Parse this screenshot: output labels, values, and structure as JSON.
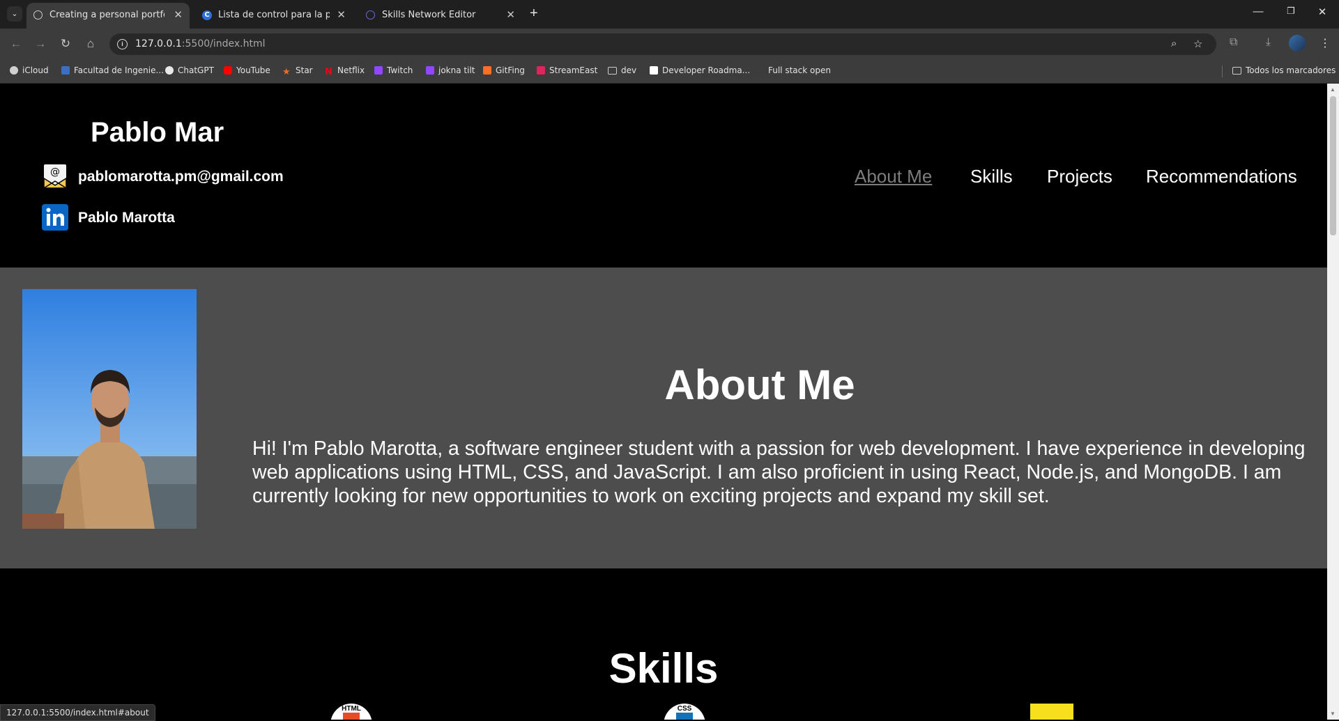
{
  "browser": {
    "tabs": [
      {
        "title": "Creating a personal portfolio",
        "active": true,
        "icon": "globe-icon"
      },
      {
        "title": "Lista de control para la present",
        "active": false,
        "icon": "c-icon"
      },
      {
        "title": "Skills Network Editor",
        "active": false,
        "icon": "editor-icon"
      }
    ],
    "url_host": "127.0.0.1",
    "url_path": ":5500/index.html",
    "bookmarks": [
      {
        "label": "iCloud",
        "icon": "apple-icon",
        "color": "#d0d0d0"
      },
      {
        "label": "Facultad de Ingenie...",
        "icon": "university-icon",
        "color": "#3a6fc4"
      },
      {
        "label": "ChatGPT",
        "icon": "chatgpt-icon",
        "color": "#e8e8e8"
      },
      {
        "label": "YouTube",
        "icon": "youtube-icon",
        "color": "#ff0000"
      },
      {
        "label": "Star",
        "icon": "star-icon",
        "color": "#f06a28"
      },
      {
        "label": "Netflix",
        "icon": "netflix-icon",
        "color": "#e50914"
      },
      {
        "label": "Twitch",
        "icon": "twitch-icon",
        "color": "#9146ff"
      },
      {
        "label": "jokna tilt",
        "icon": "twitch-icon",
        "color": "#9146ff"
      },
      {
        "label": "GitFing",
        "icon": "gitlab-icon",
        "color": "#fc6d26"
      },
      {
        "label": "StreamEast",
        "icon": "streameast-icon",
        "color": "#e0245e"
      },
      {
        "label": "dev",
        "icon": "folder-icon",
        "color": "#3c3c3c"
      },
      {
        "label": "Developer Roadma...",
        "icon": "roadmap-icon",
        "color": "#ffffff"
      },
      {
        "label": "Full stack open",
        "icon": "blank-icon",
        "color": "#3c3c3c"
      }
    ],
    "all_bookmarks": "Todos los marcadores",
    "status_url": "127.0.0.1:5500/index.html#about"
  },
  "site": {
    "name": "Pablo Mar",
    "email": "pablomarotta.pm@gmail.com",
    "linkedin": "Pablo Marotta",
    "nav": [
      "About Me",
      "Skills",
      "Projects",
      "Recommendations"
    ],
    "about_title": "About Me",
    "about_text": "Hi! I'm Pablo Marotta, a software engineer student with a passion for web development. I have experience in developing web applications using HTML, CSS, and JavaScript. I am also proficient in using React, Node.js, and MongoDB. I am currently looking for new opportunities to work on exciting projects and expand my skill set.",
    "skills_title": "Skills",
    "skill_icons": [
      {
        "name": "html-icon",
        "label": "HTML",
        "color": "#e44d26"
      },
      {
        "name": "css-icon",
        "label": "CSS",
        "color": "#1572b6"
      },
      {
        "name": "javascript-icon",
        "color": "#f7df1e"
      }
    ]
  },
  "colors": {
    "header_bg": "#000000",
    "about_bg": "#4d4d4d",
    "nav_current": "#7d7d7d",
    "linkedin_blue": "#0a66c2"
  }
}
